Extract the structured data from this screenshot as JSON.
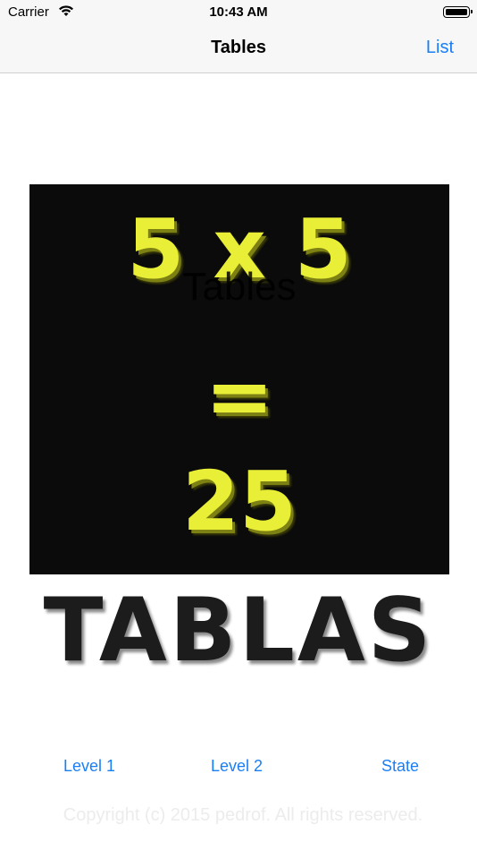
{
  "status_bar": {
    "carrier": "Carrier",
    "wifi_icon": "wifi-icon",
    "time": "10:43 AM",
    "battery_icon": "battery-icon"
  },
  "nav": {
    "title": "Tables",
    "right_button": "List"
  },
  "board": {
    "equation_top": "5 x 5",
    "equation_equals": "=",
    "equation_result": "25",
    "overlay_title": "Tables",
    "text_color": "#e9ef36",
    "background": "#0b0b0b"
  },
  "brand_text": "TABLAS",
  "tabs": [
    {
      "label": "Level 1"
    },
    {
      "label": "Level 2"
    },
    {
      "label": "State"
    }
  ],
  "footer": {
    "copyright": "Copyright (c) 2015 pedrof. All rights reserved."
  },
  "colors": {
    "accent": "#1a7ef5"
  }
}
